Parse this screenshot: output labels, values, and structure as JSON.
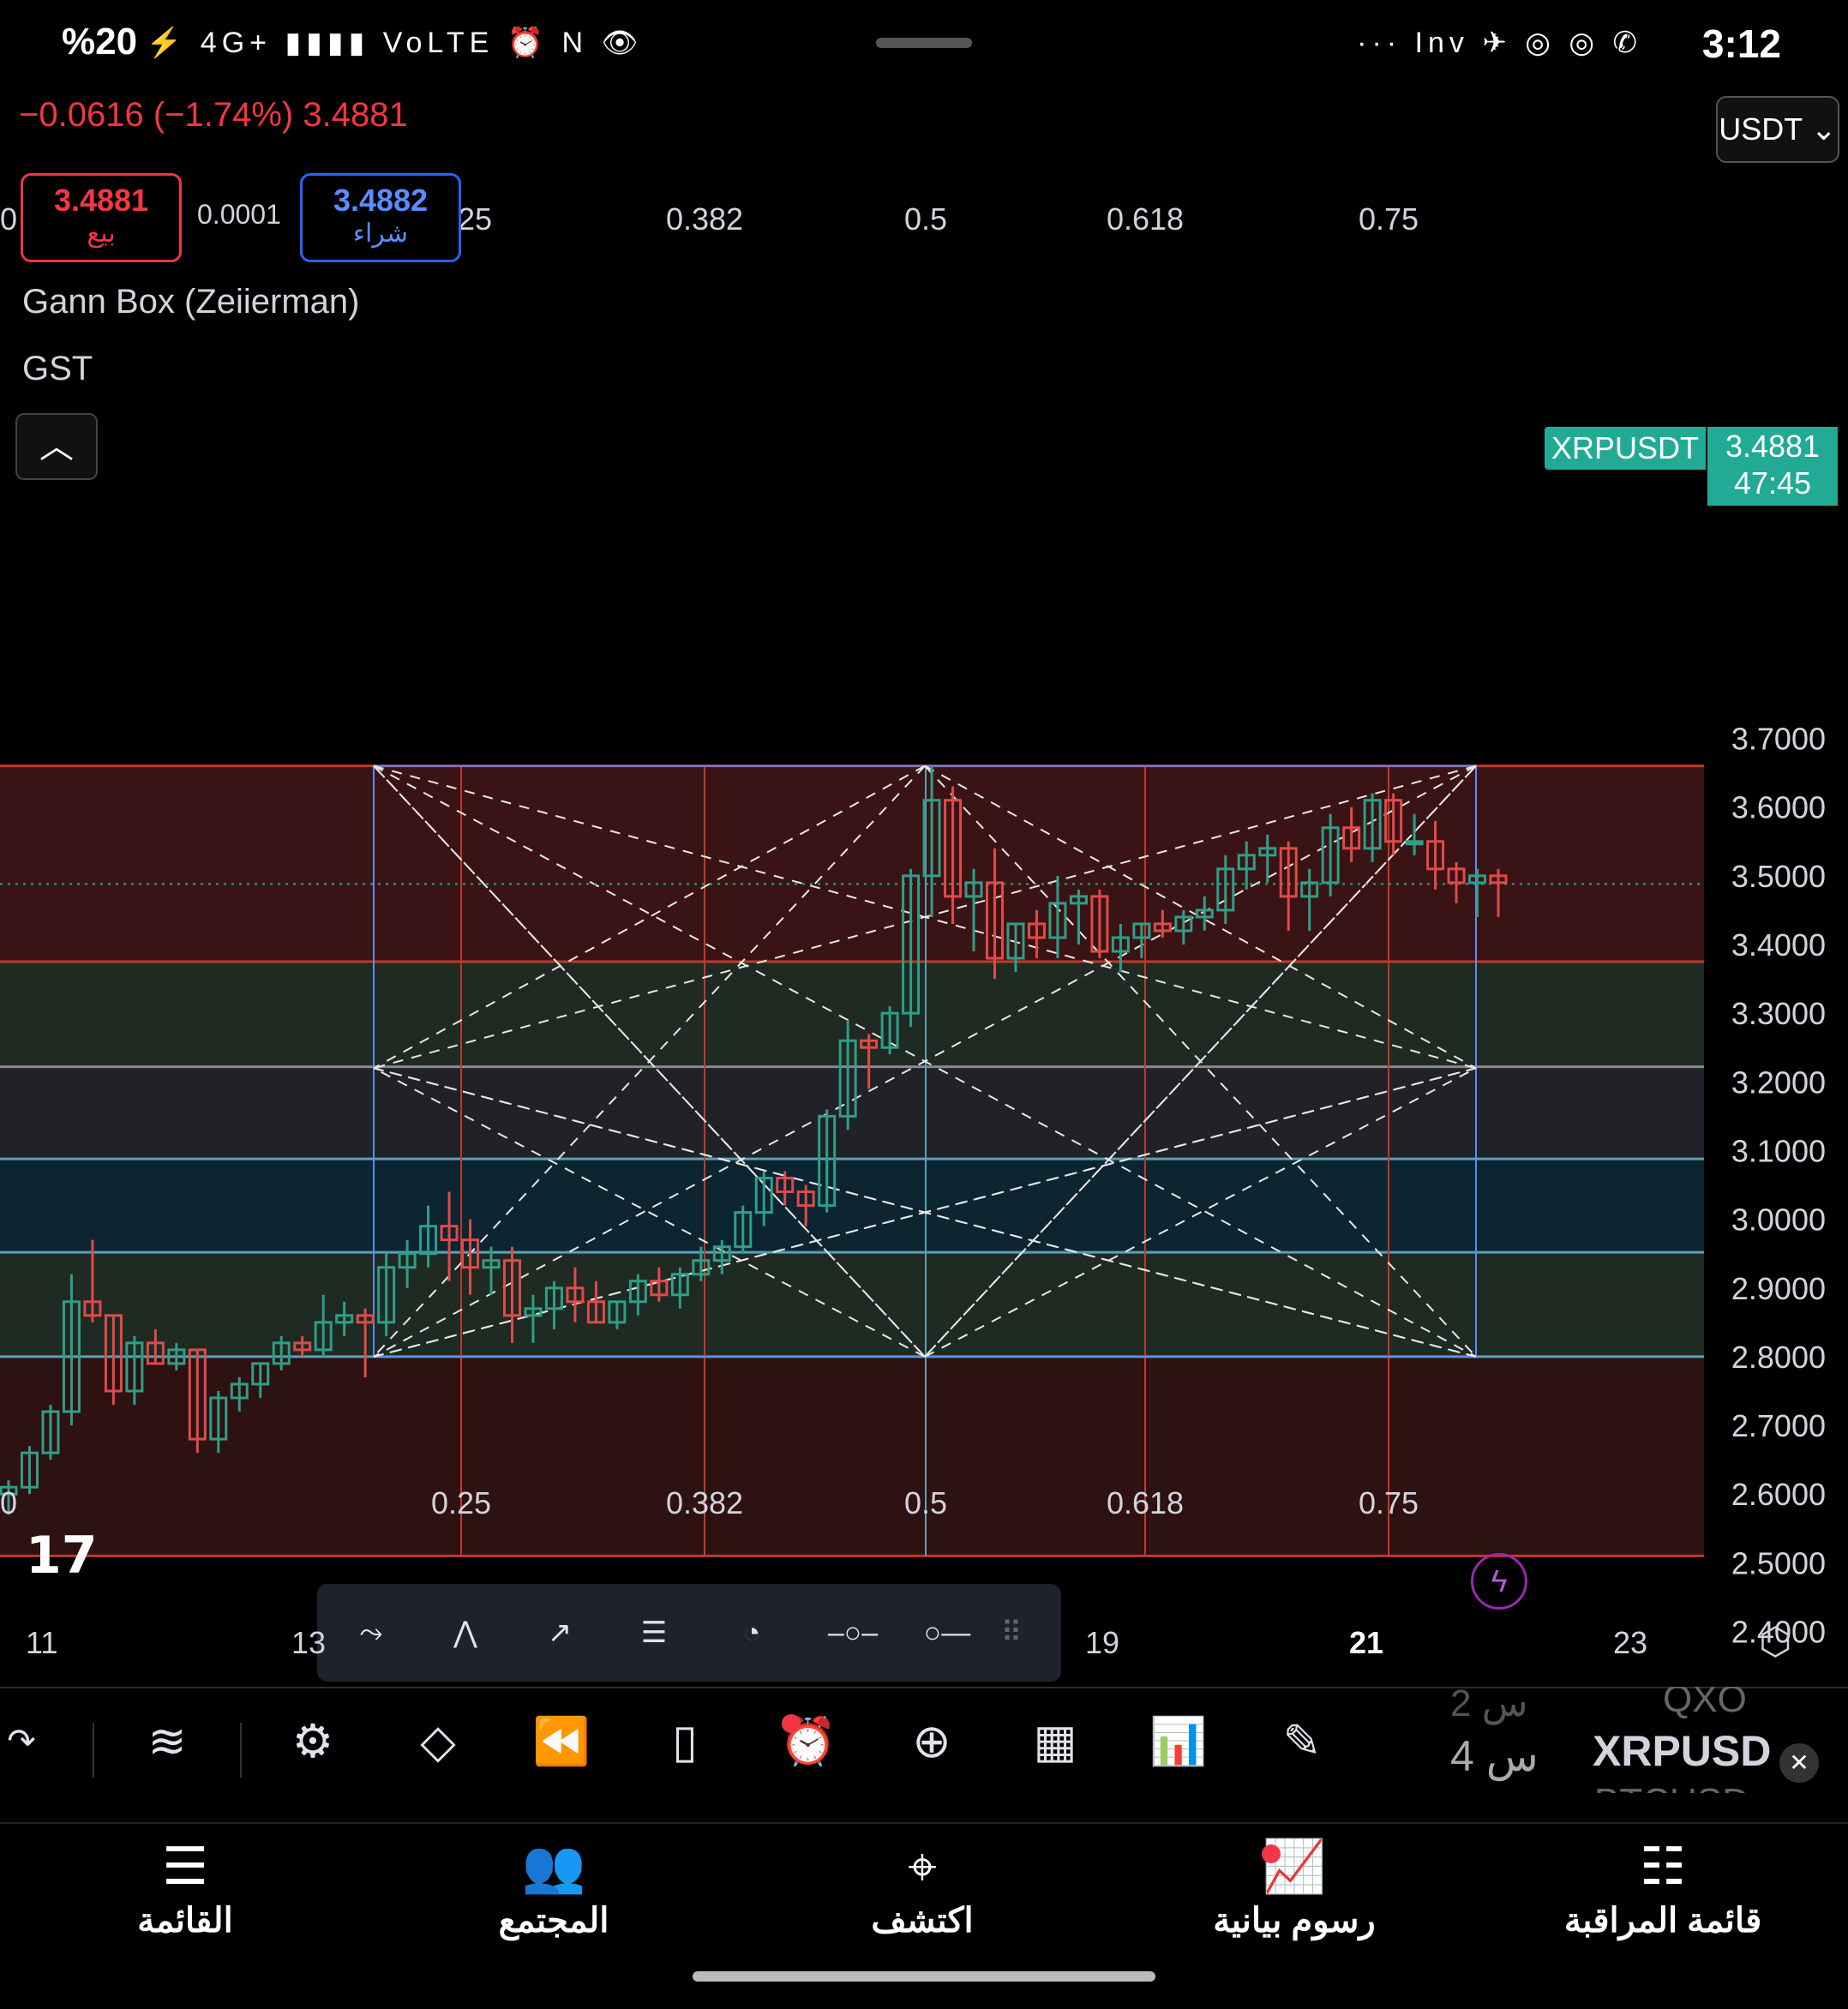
{
  "status_bar": {
    "battery": "%20",
    "left_icons": "⚡ 4G+ ▮▮▮▮ VoLTE ⏰ N 👁",
    "time": "3:12",
    "right_icons": "··· Inv ✈ ◎ ◎ ✆"
  },
  "header": {
    "change": "−0.0616 (−1.74%)  3.4881",
    "currency": "USDT ⌄"
  },
  "trade": {
    "sell_price": "3.4881",
    "sell_label": "بيع",
    "spread": "0.0001",
    "buy_price": "3.4882",
    "buy_label": "شراء"
  },
  "indicators": {
    "line1": "Gann Box (Zeiierman)",
    "line2": "GST",
    "collapse_icon": "chevron-up-icon"
  },
  "price_tag": {
    "symbol": "XRPUSDT",
    "price": "3.4881",
    "countdown": "47:45"
  },
  "chart_data": {
    "type": "candlestick",
    "symbol": "XRPUSDT",
    "price_axis": [
      "3.7000",
      "3.6000",
      "3.5000",
      "3.4000",
      "3.3000",
      "3.2000",
      "3.1000",
      "3.0000",
      "2.9000",
      "2.8000",
      "2.7000",
      "2.6000",
      "2.5000",
      "2.4000"
    ],
    "ylim": [
      2.35,
      3.75
    ],
    "time_axis": [
      "11",
      "13",
      "19",
      "21",
      "23"
    ],
    "gann_levels_top": [
      "25",
      "0.382",
      "0.5",
      "0.618",
      "0.75"
    ],
    "gann_levels_bottom": [
      "0",
      "0.25",
      "0.382",
      "0.5",
      "0.618",
      "0.75"
    ],
    "gann_top_left_partial": "0",
    "gann_box": {
      "price_top": 3.66,
      "price_bottom": 2.8
    },
    "bands": [
      {
        "from": 3.66,
        "to": 3.375,
        "color": "#3a1414"
      },
      {
        "from": 3.375,
        "to": 3.222,
        "color": "#1f2a22"
      },
      {
        "from": 3.222,
        "to": 3.088,
        "color": "#212228"
      },
      {
        "from": 3.088,
        "to": 2.952,
        "color": "#0c2530"
      },
      {
        "from": 2.952,
        "to": 2.8,
        "color": "#1f2a22"
      },
      {
        "from": 2.8,
        "to": 2.51,
        "color": "#2e1111"
      }
    ],
    "last_price": 3.4881,
    "candles": [
      [
        2.6,
        2.62,
        2.57,
        2.61
      ],
      [
        2.61,
        2.67,
        2.6,
        2.66
      ],
      [
        2.66,
        2.73,
        2.65,
        2.72
      ],
      [
        2.72,
        2.92,
        2.7,
        2.88
      ],
      [
        2.88,
        2.97,
        2.85,
        2.86
      ],
      [
        2.86,
        2.86,
        2.73,
        2.75
      ],
      [
        2.75,
        2.83,
        2.73,
        2.82
      ],
      [
        2.82,
        2.84,
        2.79,
        2.79
      ],
      [
        2.79,
        2.82,
        2.78,
        2.81
      ],
      [
        2.81,
        2.81,
        2.66,
        2.68
      ],
      [
        2.68,
        2.75,
        2.66,
        2.74
      ],
      [
        2.74,
        2.77,
        2.72,
        2.76
      ],
      [
        2.76,
        2.79,
        2.74,
        2.79
      ],
      [
        2.79,
        2.83,
        2.78,
        2.82
      ],
      [
        2.82,
        2.83,
        2.8,
        2.81
      ],
      [
        2.81,
        2.89,
        2.8,
        2.85
      ],
      [
        2.85,
        2.88,
        2.83,
        2.86
      ],
      [
        2.86,
        2.87,
        2.77,
        2.85
      ],
      [
        2.85,
        2.95,
        2.83,
        2.93
      ],
      [
        2.93,
        2.97,
        2.9,
        2.95
      ],
      [
        2.95,
        3.02,
        2.93,
        2.99
      ],
      [
        2.99,
        3.04,
        2.91,
        2.97
      ],
      [
        2.97,
        3.0,
        2.89,
        2.93
      ],
      [
        2.93,
        2.96,
        2.89,
        2.94
      ],
      [
        2.94,
        2.96,
        2.82,
        2.86
      ],
      [
        2.86,
        2.89,
        2.82,
        2.87
      ],
      [
        2.87,
        2.91,
        2.84,
        2.9
      ],
      [
        2.9,
        2.93,
        2.85,
        2.88
      ],
      [
        2.88,
        2.91,
        2.85,
        2.85
      ],
      [
        2.85,
        2.88,
        2.84,
        2.88
      ],
      [
        2.88,
        2.92,
        2.86,
        2.91
      ],
      [
        2.91,
        2.93,
        2.88,
        2.89
      ],
      [
        2.89,
        2.93,
        2.87,
        2.92
      ],
      [
        2.92,
        2.96,
        2.91,
        2.94
      ],
      [
        2.94,
        2.97,
        2.92,
        2.96
      ],
      [
        2.96,
        3.02,
        2.95,
        3.01
      ],
      [
        3.01,
        3.07,
        2.99,
        3.06
      ],
      [
        3.06,
        3.07,
        3.02,
        3.04
      ],
      [
        3.04,
        3.05,
        2.99,
        3.02
      ],
      [
        3.02,
        3.16,
        3.01,
        3.15
      ],
      [
        3.15,
        3.29,
        3.13,
        3.26
      ],
      [
        3.26,
        3.27,
        3.19,
        3.25
      ],
      [
        3.25,
        3.31,
        3.24,
        3.3
      ],
      [
        3.3,
        3.51,
        3.28,
        3.5
      ],
      [
        3.5,
        3.66,
        3.44,
        3.61
      ],
      [
        3.61,
        3.63,
        3.43,
        3.47
      ],
      [
        3.47,
        3.51,
        3.39,
        3.49
      ],
      [
        3.49,
        3.54,
        3.35,
        3.38
      ],
      [
        3.38,
        3.43,
        3.36,
        3.43
      ],
      [
        3.43,
        3.45,
        3.38,
        3.41
      ],
      [
        3.41,
        3.5,
        3.38,
        3.46
      ],
      [
        3.46,
        3.48,
        3.4,
        3.47
      ],
      [
        3.47,
        3.48,
        3.38,
        3.39
      ],
      [
        3.39,
        3.43,
        3.36,
        3.41
      ],
      [
        3.41,
        3.43,
        3.38,
        3.43
      ],
      [
        3.43,
        3.45,
        3.41,
        3.42
      ],
      [
        3.42,
        3.45,
        3.4,
        3.44
      ],
      [
        3.44,
        3.47,
        3.42,
        3.45
      ],
      [
        3.45,
        3.53,
        3.43,
        3.51
      ],
      [
        3.51,
        3.55,
        3.48,
        3.53
      ],
      [
        3.53,
        3.56,
        3.49,
        3.54
      ],
      [
        3.54,
        3.55,
        3.42,
        3.47
      ],
      [
        3.47,
        3.51,
        3.42,
        3.49
      ],
      [
        3.49,
        3.59,
        3.47,
        3.57
      ],
      [
        3.57,
        3.6,
        3.52,
        3.54
      ],
      [
        3.54,
        3.62,
        3.52,
        3.61
      ],
      [
        3.61,
        3.62,
        3.53,
        3.55
      ],
      [
        3.55,
        3.59,
        3.53,
        3.55
      ],
      [
        3.55,
        3.58,
        3.48,
        3.51
      ],
      [
        3.51,
        3.52,
        3.46,
        3.49
      ],
      [
        3.49,
        3.51,
        3.44,
        3.5
      ],
      [
        3.5,
        3.51,
        3.44,
        3.49
      ]
    ]
  },
  "drawing_toolbar": [
    {
      "name": "elliott-wave-icon",
      "glyph": "⤳"
    },
    {
      "name": "xabcd-pattern-icon",
      "glyph": "⋀"
    },
    {
      "name": "trend-line-icon",
      "glyph": "↗"
    },
    {
      "name": "parallel-channel-icon",
      "glyph": "☰"
    },
    {
      "name": "fib-arc-icon",
      "glyph": "◔"
    },
    {
      "name": "ray-icon",
      "glyph": "–○–"
    },
    {
      "name": "horizontal-line-icon",
      "glyph": "○—"
    }
  ],
  "toolbar": [
    {
      "name": "redo-icon",
      "glyph": "↷"
    },
    {
      "name": "indicators-wave-icon",
      "glyph": "≋"
    },
    {
      "name": "settings-sliders-icon",
      "glyph": "⚙"
    },
    {
      "name": "layers-icon",
      "glyph": "◇"
    },
    {
      "name": "replay-icon",
      "glyph": "⏪"
    },
    {
      "name": "candles-icon",
      "glyph": "▯"
    },
    {
      "name": "alarm-icon",
      "glyph": "⏰"
    },
    {
      "name": "add-icon",
      "glyph": "⊕"
    },
    {
      "name": "grid-icon",
      "glyph": "▦"
    },
    {
      "name": "chart-icon",
      "glyph": "📊"
    },
    {
      "name": "pen-icon",
      "glyph": "✎"
    }
  ],
  "watchlist_peek": {
    "sym_prev": "QXO",
    "sym": "XRPUSD",
    "sym_next": "BTCUSD",
    "time_prev": "2 س",
    "time": "4 س"
  },
  "nav": [
    {
      "label": "القائمة",
      "name": "menu-icon",
      "glyph": "☰"
    },
    {
      "label": "المجتمع",
      "name": "community-icon",
      "glyph": "👥"
    },
    {
      "label": "اكتشف",
      "name": "compass-icon",
      "glyph": "⌖"
    },
    {
      "label": "رسوم بيانية",
      "name": "charts-icon",
      "glyph": "📈"
    },
    {
      "label": "قائمة المراقبة",
      "name": "watchlist-icon",
      "glyph": "☷"
    }
  ]
}
